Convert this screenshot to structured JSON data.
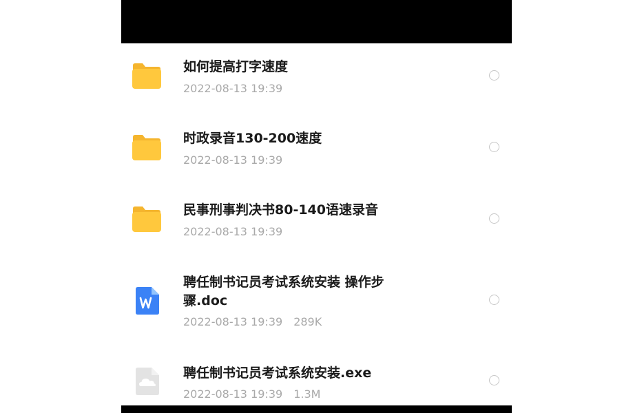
{
  "files": [
    {
      "name": "如何提高打字速度",
      "date": "2022-08-13 19:39",
      "size": "",
      "icon": "folder-icon"
    },
    {
      "name": "时政录音130-200速度",
      "date": "2022-08-13 19:39",
      "size": "",
      "icon": "folder-icon"
    },
    {
      "name": "民事刑事判决书80-140语速录音",
      "date": "2022-08-13 19:39",
      "size": "",
      "icon": "folder-icon"
    },
    {
      "name": "聘任制书记员考试系统安装 操作步骤.doc",
      "date": "2022-08-13 19:39",
      "size": "289K",
      "icon": "word-doc-icon"
    },
    {
      "name": "聘任制书记员考试系统安装.exe",
      "date": "2022-08-13 19:39",
      "size": "1.3M",
      "icon": "cloud-file-icon"
    }
  ],
  "colors": {
    "folder": "#ffc83d",
    "word": "#3b82f6",
    "text": "#1a1a1a",
    "meta": "#a9a9a9"
  }
}
